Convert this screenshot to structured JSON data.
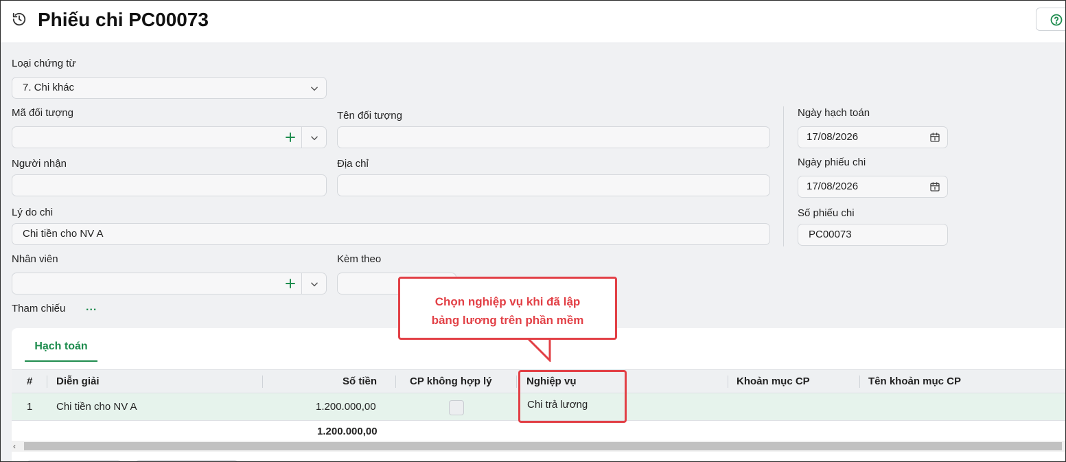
{
  "header": {
    "title": "Phiếu chi PC00073",
    "history_icon": "history-icon",
    "help_icon": "help-circle-icon"
  },
  "form": {
    "loai_chung_tu": {
      "label": "Loại chứng từ",
      "value": "7. Chi khác"
    },
    "ma_doi_tuong": {
      "label": "Mã đối tượng",
      "value": ""
    },
    "ten_doi_tuong": {
      "label": "Tên đối tượng",
      "value": ""
    },
    "nguoi_nhan": {
      "label": "Người nhận",
      "value": ""
    },
    "dia_chi": {
      "label": "Địa chỉ",
      "value": ""
    },
    "ly_do_chi": {
      "label": "Lý do chi",
      "value": "Chi tiền cho NV A"
    },
    "nhan_vien": {
      "label": "Nhân viên",
      "value": ""
    },
    "kem_theo": {
      "label": "Kèm theo",
      "value": ""
    },
    "tham_chieu": {
      "label": "Tham chiếu",
      "action": "..."
    },
    "ngay_hach_toan": {
      "label": "Ngày hạch toán",
      "value": "17/08/2026"
    },
    "ngay_phieu_chi": {
      "label": "Ngày phiếu chi",
      "value": "17/08/2026"
    },
    "so_phieu_chi": {
      "label": "Số phiếu chi",
      "value": "PC00073"
    }
  },
  "tabs": [
    {
      "label": "Hạch toán",
      "active": true
    }
  ],
  "table": {
    "columns": [
      "#",
      "Diễn giải",
      "Số tiền",
      "CP không hợp lý",
      "Nghiệp vụ",
      "Khoản mục CP",
      "Tên khoản mục CP"
    ],
    "rows": [
      {
        "index": "1",
        "dien_giai": "Chi tiền cho NV A",
        "so_tien": "1.200.000,00",
        "cp_khong_hop_ly": false,
        "nghiep_vu": "Chi trả lương",
        "khoan_muc_cp": "",
        "ten_khoan_muc_cp": ""
      }
    ],
    "total_so_tien": "1.200.000,00"
  },
  "annotation": {
    "line1": "Chọn nghiệp vụ khi đã lập",
    "line2": "bảng lương trên phần mềm",
    "color": "#e24046"
  },
  "colors": {
    "accent_green": "#1e8c4e",
    "annotation_red": "#e24046",
    "row_highlight": "#e6f3ec"
  }
}
